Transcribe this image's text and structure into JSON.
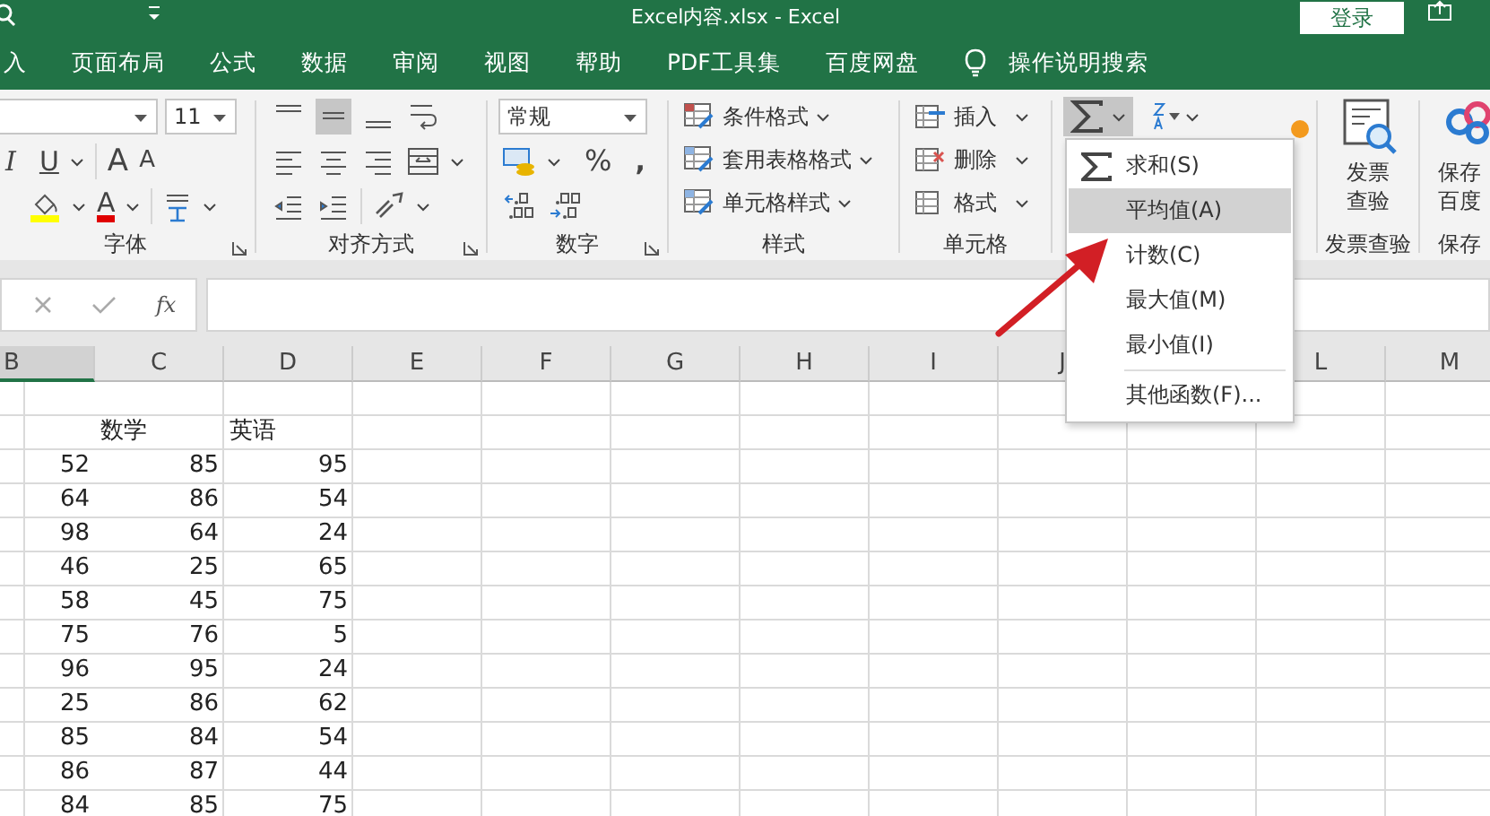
{
  "window": {
    "title": "Excel内容.xlsx  -  Excel",
    "login_button": "登录"
  },
  "ribbon_tabs": [
    "入",
    "页面布局",
    "公式",
    "数据",
    "审阅",
    "视图",
    "帮助",
    "PDF工具集",
    "百度网盘"
  ],
  "search_hint": "操作说明搜索",
  "font_group": {
    "label": "字体",
    "font_size": "11",
    "italic": "I",
    "underline": "U",
    "grow": "A",
    "shrink": "A",
    "font_color": "A"
  },
  "alignment_group": {
    "label": "对齐方式"
  },
  "number_group": {
    "label": "数字",
    "format": "常规",
    "percent": "%",
    "comma": ","
  },
  "styles_group": {
    "label": "样式",
    "commands": [
      "条件格式",
      "套用表格格式",
      "单元格样式"
    ]
  },
  "cells_group": {
    "label": "单元格",
    "commands": [
      "插入",
      "删除",
      "格式"
    ]
  },
  "editing_group": {
    "autosum_pressed": true
  },
  "invoice_group": {
    "button": [
      "发票",
      "查验"
    ],
    "label": "发票查验"
  },
  "save_group": {
    "button": [
      "保存",
      "百度"
    ],
    "label": "保存"
  },
  "formula_bar": {
    "fx": "fx"
  },
  "columns": [
    {
      "label": "B",
      "selected": true
    },
    {
      "label": "C",
      "selected": false
    },
    {
      "label": "D",
      "selected": false
    },
    {
      "label": "E",
      "selected": false
    },
    {
      "label": "F",
      "selected": false
    },
    {
      "label": "G",
      "selected": false
    },
    {
      "label": "H",
      "selected": false
    },
    {
      "label": "I",
      "selected": false
    },
    {
      "label": "J",
      "selected": false
    },
    {},
    {
      "label": "L",
      "selected": false
    },
    {
      "label": "M",
      "selected": false
    }
  ],
  "rows": [
    [],
    [
      "",
      "数学",
      "英语"
    ],
    [
      "52",
      "85",
      "95"
    ],
    [
      "64",
      "86",
      "54"
    ],
    [
      "98",
      "64",
      "24"
    ],
    [
      "46",
      "25",
      "65"
    ],
    [
      "58",
      "45",
      "75"
    ],
    [
      "75",
      "76",
      "5"
    ],
    [
      "96",
      "95",
      "24"
    ],
    [
      "25",
      "86",
      "62"
    ],
    [
      "85",
      "84",
      "54"
    ],
    [
      "86",
      "87",
      "44"
    ],
    [
      "84",
      "85",
      "75"
    ]
  ],
  "autosum_menu": [
    {
      "kind": "item",
      "label": "求和(S)",
      "selected": false
    },
    {
      "kind": "item",
      "label": "平均值(A)",
      "selected": true
    },
    {
      "kind": "item",
      "label": "计数(C)",
      "selected": false
    },
    {
      "kind": "item",
      "label": "最大值(M)",
      "selected": false
    },
    {
      "kind": "item",
      "label": "最小值(I)",
      "selected": false
    },
    {
      "kind": "separator"
    },
    {
      "kind": "item",
      "label": "其他函数(F)...",
      "selected": false
    }
  ]
}
